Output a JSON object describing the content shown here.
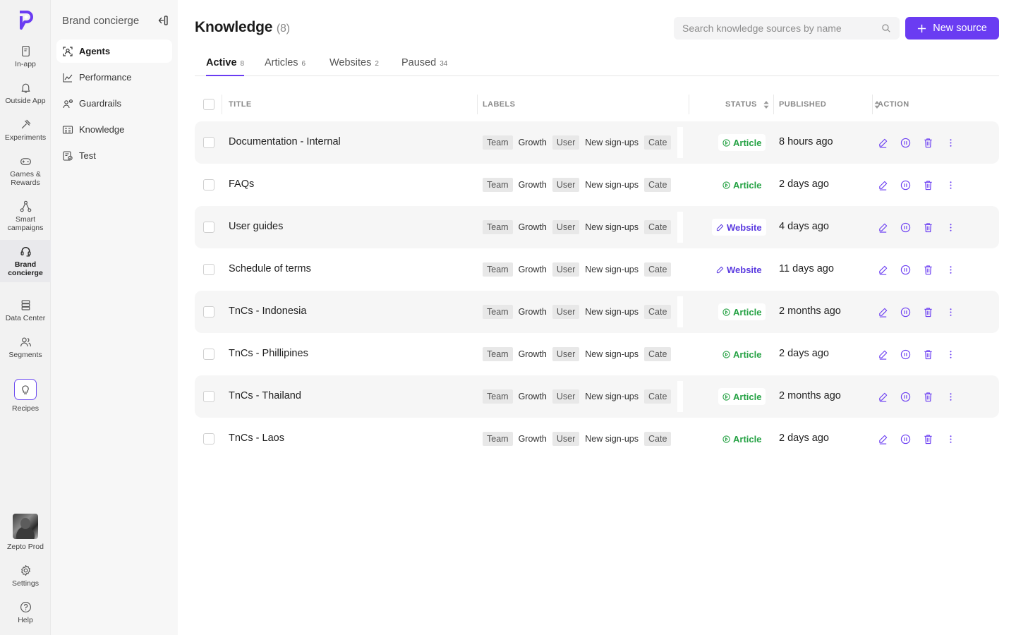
{
  "rail": {
    "items": [
      {
        "label": "In-app",
        "icon": "in-app-icon"
      },
      {
        "label": "Outside App",
        "icon": "bell-icon"
      },
      {
        "label": "Experiments",
        "icon": "experiments-icon"
      },
      {
        "label": "Games & Rewards",
        "icon": "gamepad-icon"
      },
      {
        "label": "Smart campaigns",
        "icon": "network-icon"
      },
      {
        "label": "Brand concierge",
        "icon": "headset-icon"
      },
      {
        "label": "Data Center",
        "icon": "database-icon"
      },
      {
        "label": "Segments",
        "icon": "users-icon"
      },
      {
        "label": "Recipes",
        "icon": "lightbulb-icon"
      }
    ],
    "profile": "Zepto Prod",
    "settings": "Settings",
    "help": "Help"
  },
  "subnav": {
    "title": "Brand concierge",
    "items": [
      "Agents",
      "Performance",
      "Guardrails",
      "Knowledge",
      "Test"
    ]
  },
  "header": {
    "title": "Knowledge",
    "count": "(8)",
    "search_placeholder": "Search knowledge sources by name",
    "new_button": "New source"
  },
  "tabs": [
    {
      "label": "Active",
      "count": "8"
    },
    {
      "label": "Articles",
      "count": "6"
    },
    {
      "label": "Websites",
      "count": "2"
    },
    {
      "label": "Paused",
      "count": "34"
    }
  ],
  "table": {
    "columns": [
      "TITLE",
      "LABELS",
      "STATUS",
      "PUBLISHED",
      "ACTION"
    ],
    "labels": [
      "Team",
      "Growth",
      "User",
      "New sign-ups",
      "Cate"
    ],
    "rows": [
      {
        "title": "Documentation - Internal",
        "status": "Article",
        "published": "8 hours ago"
      },
      {
        "title": "FAQs",
        "status": "Article",
        "published": "2 days ago"
      },
      {
        "title": "User guides",
        "status": "Website",
        "published": "4 days ago"
      },
      {
        "title": "Schedule of terms",
        "status": "Website",
        "published": "11 days ago"
      },
      {
        "title": "TnCs - Indonesia",
        "status": "Article",
        "published": "2 months ago"
      },
      {
        "title": "TnCs - Phillipines",
        "status": "Article",
        "published": "2 days ago"
      },
      {
        "title": "TnCs - Thailand",
        "status": "Article",
        "published": "2 months ago"
      },
      {
        "title": "TnCs - Laos",
        "status": "Article",
        "published": "2 days ago"
      }
    ]
  },
  "colors": {
    "accent": "#6a3cf2",
    "article": "#25a244",
    "website": "#5b3be0"
  }
}
